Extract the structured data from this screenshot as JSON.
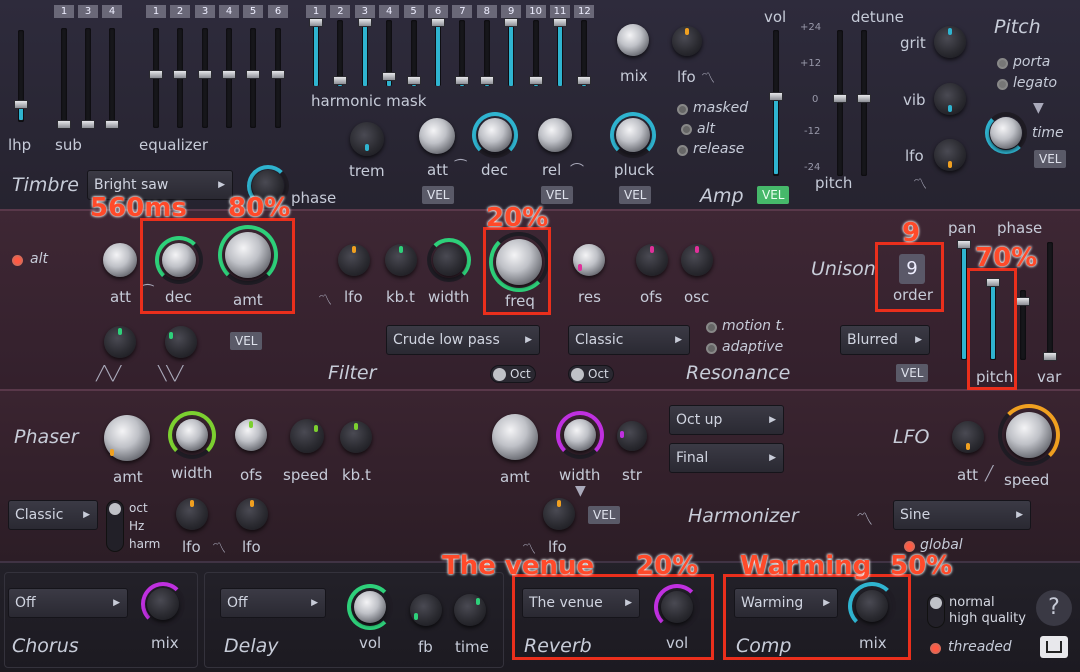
{
  "timbre": {
    "name": "Timbre",
    "lhp": "lhp",
    "sub": "sub",
    "sub_tabs": [
      "1",
      "3",
      "4"
    ],
    "equalizer": "equalizer",
    "eq_tabs": [
      "1",
      "2",
      "3",
      "4",
      "5",
      "6"
    ],
    "harmonic_mask": "harmonic mask",
    "hm_tabs": [
      "1",
      "2",
      "3",
      "4",
      "5",
      "6",
      "7",
      "8",
      "9",
      "10",
      "11",
      "12"
    ],
    "preset": "Bright saw",
    "phase": "phase",
    "trem": "trem",
    "att": "att",
    "dec": "dec",
    "rel": "rel",
    "pluck": "pluck",
    "vel": "VEL",
    "mix": "mix",
    "lfo": "lfo",
    "masked": "masked",
    "alt": "alt",
    "release": "release"
  },
  "amp": {
    "name": "Amp",
    "vol": "vol",
    "vel": "VEL",
    "scale": [
      "+24",
      "+12",
      "0",
      "-12",
      "-24"
    ]
  },
  "pitch": {
    "name": "Pitch",
    "detune": "detune",
    "pitch": "pitch",
    "grit": "grit",
    "vib": "vib",
    "lfo": "lfo",
    "porta": "porta",
    "legato": "legato",
    "time": "time",
    "vel": "VEL"
  },
  "filter": {
    "name": "Filter",
    "alt": "alt",
    "att": "att",
    "dec": "dec",
    "amt": "amt",
    "lfo": "lfo",
    "kbt": "kb.t",
    "width": "width",
    "freq": "freq",
    "res": "res",
    "ofs": "ofs",
    "osc": "osc",
    "vel": "VEL",
    "type": "Crude low pass",
    "oct": "Oct"
  },
  "resonance": {
    "name": "Resonance",
    "type": "Classic",
    "oct": "Oct",
    "motion": "motion t.",
    "adaptive": "adaptive"
  },
  "unison": {
    "name": "Unison",
    "order_value": "9",
    "order": "order",
    "pan": "pan",
    "phase": "phase",
    "pitch": "pitch",
    "var": "var",
    "mode": "Blurred",
    "vel": "VEL"
  },
  "phaser": {
    "name": "Phaser",
    "amt": "amt",
    "width": "width",
    "ofs": "ofs",
    "speed": "speed",
    "kbt": "kb.t",
    "mode": "Classic",
    "oct": "oct",
    "hz": "Hz",
    "harm": "harm",
    "lfo": "lfo"
  },
  "harmonizer": {
    "name": "Harmonizer",
    "amt": "amt",
    "width": "width",
    "str": "str",
    "vel": "VEL",
    "lfo": "lfo",
    "mode1": "Oct up",
    "mode2": "Final"
  },
  "lfo": {
    "name": "LFO",
    "att": "att",
    "speed": "speed",
    "shape": "Sine",
    "global": "global"
  },
  "chorus": {
    "name": "Chorus",
    "mode": "Off",
    "mix": "mix"
  },
  "delay": {
    "name": "Delay",
    "mode": "Off",
    "vol": "vol",
    "fb": "fb",
    "time": "time"
  },
  "reverb": {
    "name": "Reverb",
    "mode": "The venue",
    "vol": "vol"
  },
  "comp": {
    "name": "Comp",
    "mode": "Warming",
    "mix": "mix"
  },
  "quality": {
    "normal": "normal",
    "high": "high quality",
    "threaded": "threaded",
    "help": "?"
  },
  "annotations": {
    "dec": "560ms",
    "amt": "80%",
    "freq": "20%",
    "order": "9",
    "pitch": "70%",
    "reverb_mode": "The venue",
    "reverb_vol": "20%",
    "comp_mode": "Warming",
    "comp_mix": "50%"
  },
  "colors": {
    "accent": "#2fb4d0",
    "green": "#2ed07a",
    "annotation": "#ea2f1c"
  }
}
